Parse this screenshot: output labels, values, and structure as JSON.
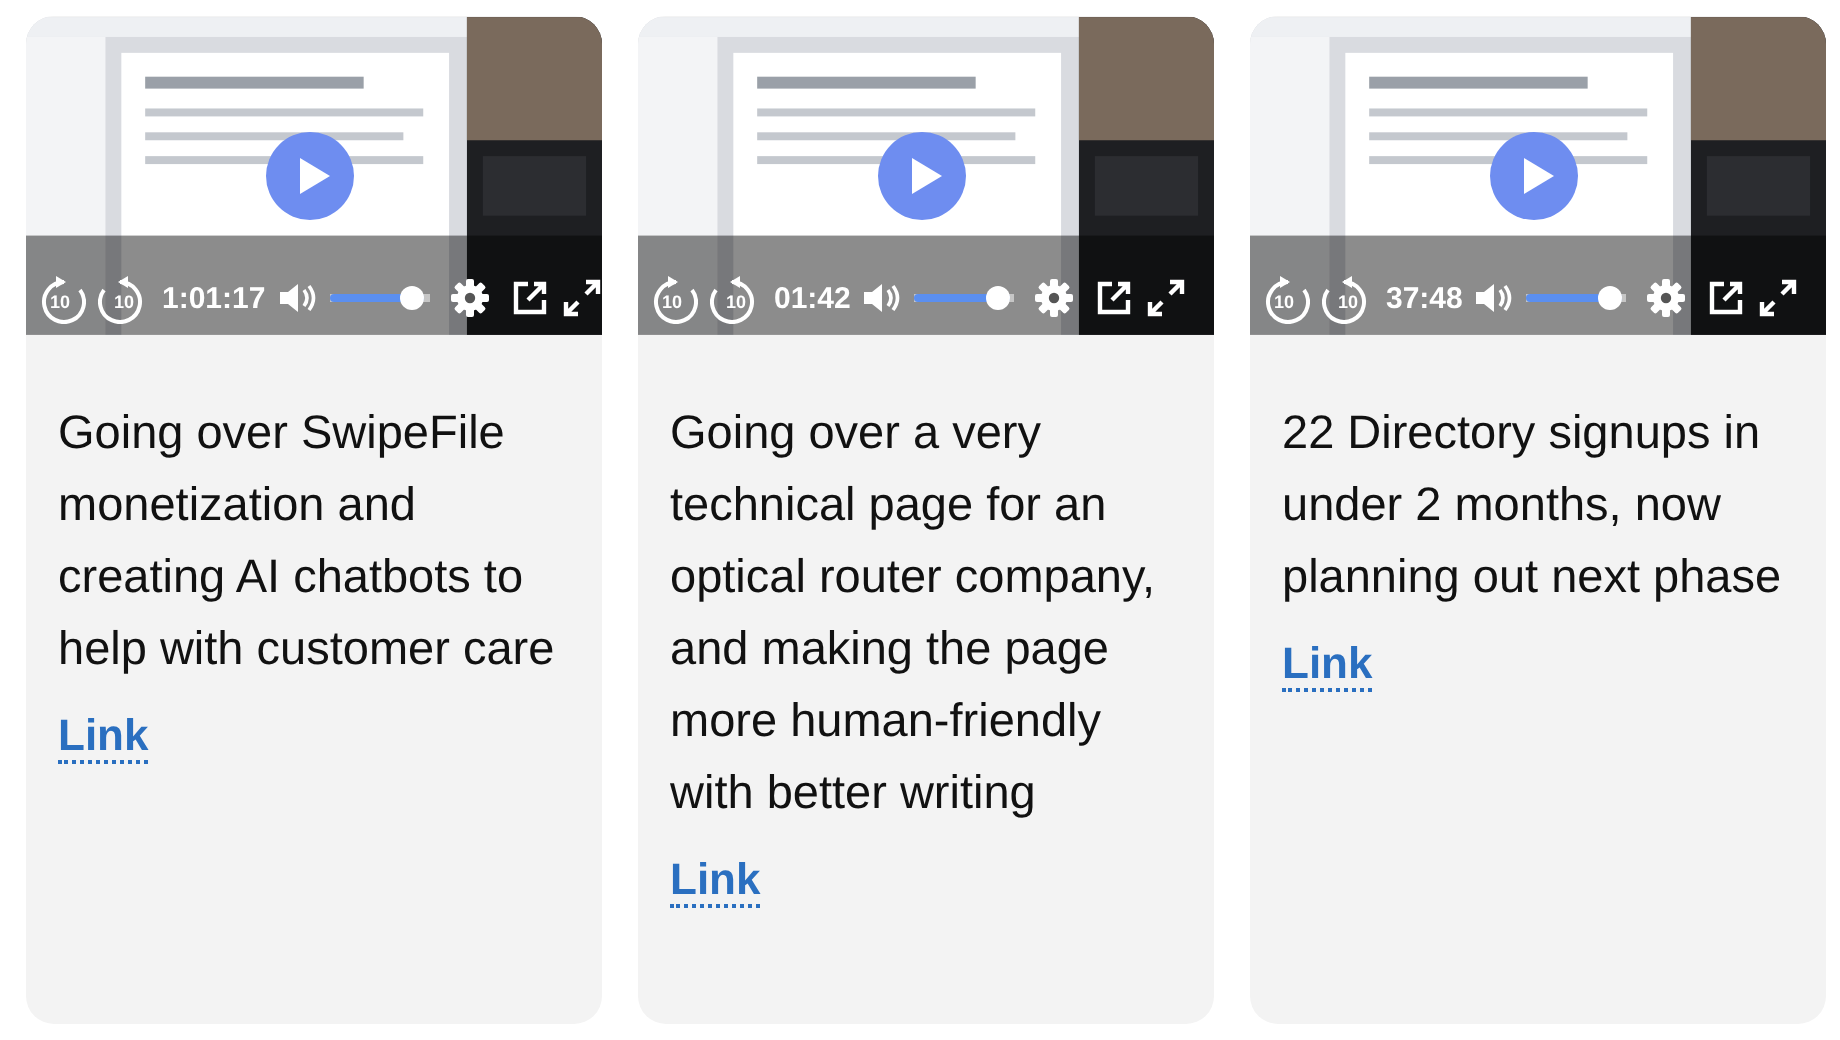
{
  "cards": [
    {
      "video": {
        "time": "1:01:17",
        "skip_back": "10",
        "skip_forward": "10",
        "volume": {
          "level": 0.95
        }
      },
      "description": "Going over SwipeFile monetization and creating AI chatbots to help with customer care",
      "link": "Link"
    },
    {
      "video": {
        "time": "01:42",
        "skip_back": "10",
        "skip_forward": "10",
        "volume": {
          "level": 0.95
        }
      },
      "description": "Going over a very technical page for an optical router company, and making the page more human-friendly with better writing",
      "link": "Link"
    },
    {
      "video": {
        "time": "37:48",
        "skip_back": "10",
        "skip_forward": "10",
        "volume": {
          "level": 0.95
        }
      },
      "description": "22 Directory signups in under 2 months, now planning out next phase",
      "link": "Link"
    }
  ]
}
